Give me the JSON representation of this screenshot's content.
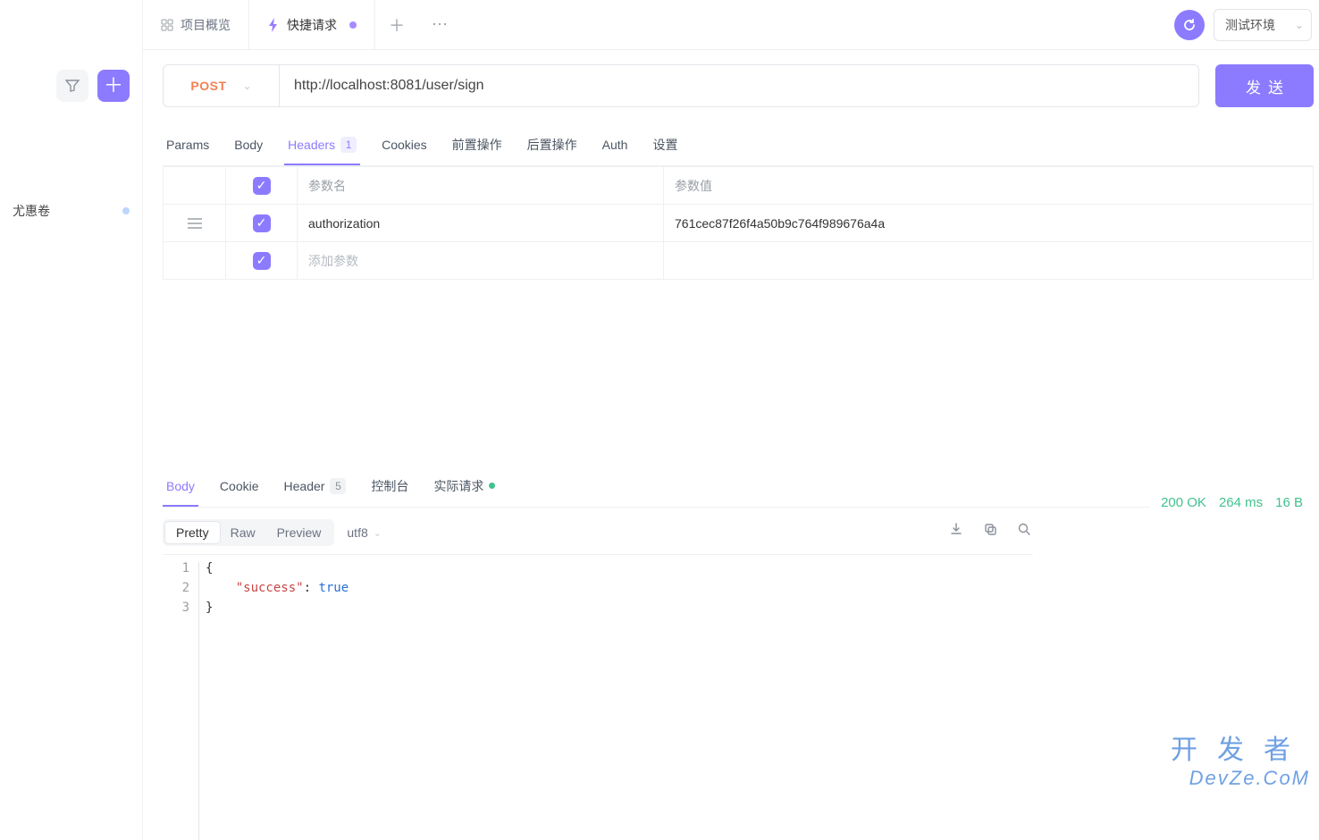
{
  "sidebar": {
    "tree_item": "尤惠卷"
  },
  "tabs": {
    "overview": "项目概览",
    "active": "快捷请求"
  },
  "env": {
    "label": "测试环境"
  },
  "request": {
    "method": "POST",
    "url": "http://localhost:8081/user/sign",
    "send": "发送"
  },
  "req_tabs": {
    "params": "Params",
    "body": "Body",
    "headers": "Headers",
    "headers_badge": "1",
    "cookies": "Cookies",
    "pre": "前置操作",
    "post": "后置操作",
    "auth": "Auth",
    "settings": "设置"
  },
  "headers_table": {
    "col_name": "参数名",
    "col_value": "参数值",
    "rows": [
      {
        "name": "authorization",
        "value": "761cec87f26f4a50b9c764f989676a4a"
      }
    ],
    "add_placeholder": "添加参数"
  },
  "resp_tabs": {
    "body": "Body",
    "cookie": "Cookie",
    "header": "Header",
    "header_badge": "5",
    "console": "控制台",
    "actual": "实际请求"
  },
  "status": {
    "code": "200 OK",
    "time": "264 ms",
    "size": "16 B"
  },
  "view": {
    "pretty": "Pretty",
    "raw": "Raw",
    "preview": "Preview",
    "encoding": "utf8"
  },
  "response_code": {
    "line1_no": "1",
    "line2_no": "2",
    "line3_no": "3",
    "open": "{",
    "key": "\"success\"",
    "colon": ": ",
    "val": "true",
    "close": "}"
  },
  "watermark": {
    "top": "开发者",
    "bottom": "DevZe.CoM"
  }
}
